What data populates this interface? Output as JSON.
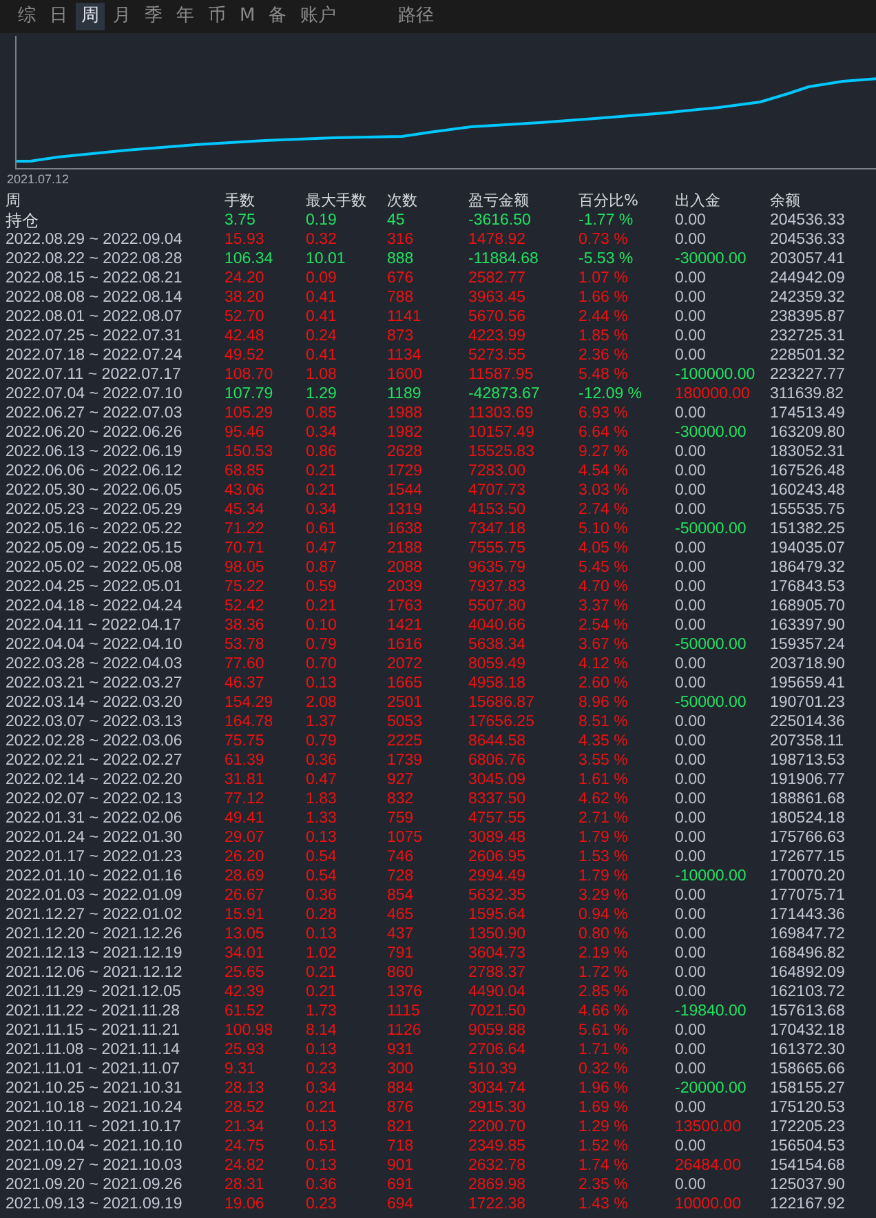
{
  "tabs": [
    {
      "label": "综",
      "selected": false
    },
    {
      "label": "日",
      "selected": false
    },
    {
      "label": "周",
      "selected": true
    },
    {
      "label": "月",
      "selected": false
    },
    {
      "label": "季",
      "selected": false
    },
    {
      "label": "年",
      "selected": false
    },
    {
      "label": "币",
      "selected": false
    },
    {
      "label": "M",
      "selected": false
    },
    {
      "label": "备",
      "selected": false
    },
    {
      "label": "账户",
      "selected": false
    },
    {
      "label": "路径",
      "selected": false
    }
  ],
  "chart": {
    "start_label": "2021.07.12"
  },
  "table": {
    "columns": [
      "周",
      "手数",
      "最大手数",
      "次数",
      "盈亏金额",
      "百分比%",
      "出入金",
      "余额"
    ],
    "rows": [
      {
        "period": "持仓",
        "lots": "3.75",
        "max_lots": "0.19",
        "count": "45",
        "pnl": "-3616.50",
        "pct": "-1.77 %",
        "flow": {
          "text": "0.00",
          "color": "#b8c0cc"
        },
        "balance": "204536.33",
        "kind": "loss"
      },
      {
        "period": "2022.08.29 ~ 2022.09.04",
        "lots": "15.93",
        "max_lots": "0.32",
        "count": "316",
        "pnl": "1478.92",
        "pct": "0.73 %",
        "flow": {
          "text": "0.00",
          "color": "#b8c0cc"
        },
        "balance": "204536.33",
        "kind": "gain"
      },
      {
        "period": "2022.08.22 ~ 2022.08.28",
        "lots": "106.34",
        "max_lots": "10.01",
        "count": "888",
        "pnl": "-11884.68",
        "pct": "-5.53 %",
        "flow": {
          "text": "-30000.00",
          "color": "#22e060"
        },
        "balance": "203057.41",
        "kind": "loss"
      },
      {
        "period": "2022.08.15 ~ 2022.08.21",
        "lots": "24.20",
        "max_lots": "0.09",
        "count": "676",
        "pnl": "2582.77",
        "pct": "1.07 %",
        "flow": {
          "text": "0.00",
          "color": "#b8c0cc"
        },
        "balance": "244942.09",
        "kind": "gain"
      },
      {
        "period": "2022.08.08 ~ 2022.08.14",
        "lots": "38.20",
        "max_lots": "0.41",
        "count": "788",
        "pnl": "3963.45",
        "pct": "1.66 %",
        "flow": {
          "text": "0.00",
          "color": "#b8c0cc"
        },
        "balance": "242359.32",
        "kind": "gain"
      },
      {
        "period": "2022.08.01 ~ 2022.08.07",
        "lots": "52.70",
        "max_lots": "0.41",
        "count": "1141",
        "pnl": "5670.56",
        "pct": "2.44 %",
        "flow": {
          "text": "0.00",
          "color": "#b8c0cc"
        },
        "balance": "238395.87",
        "kind": "gain"
      },
      {
        "period": "2022.07.25 ~ 2022.07.31",
        "lots": "42.48",
        "max_lots": "0.24",
        "count": "873",
        "pnl": "4223.99",
        "pct": "1.85 %",
        "flow": {
          "text": "0.00",
          "color": "#b8c0cc"
        },
        "balance": "232725.31",
        "kind": "gain"
      },
      {
        "period": "2022.07.18 ~ 2022.07.24",
        "lots": "49.52",
        "max_lots": "0.41",
        "count": "1134",
        "pnl": "5273.55",
        "pct": "2.36 %",
        "flow": {
          "text": "0.00",
          "color": "#b8c0cc"
        },
        "balance": "228501.32",
        "kind": "gain"
      },
      {
        "period": "2022.07.11 ~ 2022.07.17",
        "lots": "108.70",
        "max_lots": "1.08",
        "count": "1600",
        "pnl": "11587.95",
        "pct": "5.48 %",
        "flow": {
          "text": "-100000.00",
          "color": "#22e060"
        },
        "balance": "223227.77",
        "kind": "gain"
      },
      {
        "period": "2022.07.04 ~ 2022.07.10",
        "lots": "107.79",
        "max_lots": "1.29",
        "count": "1189",
        "pnl": "-42873.67",
        "pct": "-12.09 %",
        "flow": {
          "text": "180000.00",
          "color": "#ee1111"
        },
        "balance": "311639.82",
        "kind": "loss"
      },
      {
        "period": "2022.06.27 ~ 2022.07.03",
        "lots": "105.29",
        "max_lots": "0.85",
        "count": "1988",
        "pnl": "11303.69",
        "pct": "6.93 %",
        "flow": {
          "text": "0.00",
          "color": "#b8c0cc"
        },
        "balance": "174513.49",
        "kind": "gain"
      },
      {
        "period": "2022.06.20 ~ 2022.06.26",
        "lots": "95.46",
        "max_lots": "0.34",
        "count": "1982",
        "pnl": "10157.49",
        "pct": "6.64 %",
        "flow": {
          "text": "-30000.00",
          "color": "#22e060"
        },
        "balance": "163209.80",
        "kind": "gain"
      },
      {
        "period": "2022.06.13 ~ 2022.06.19",
        "lots": "150.53",
        "max_lots": "0.86",
        "count": "2628",
        "pnl": "15525.83",
        "pct": "9.27 %",
        "flow": {
          "text": "0.00",
          "color": "#b8c0cc"
        },
        "balance": "183052.31",
        "kind": "gain"
      },
      {
        "period": "2022.06.06 ~ 2022.06.12",
        "lots": "68.85",
        "max_lots": "0.21",
        "count": "1729",
        "pnl": "7283.00",
        "pct": "4.54 %",
        "flow": {
          "text": "0.00",
          "color": "#b8c0cc"
        },
        "balance": "167526.48",
        "kind": "gain"
      },
      {
        "period": "2022.05.30 ~ 2022.06.05",
        "lots": "43.06",
        "max_lots": "0.21",
        "count": "1544",
        "pnl": "4707.73",
        "pct": "3.03 %",
        "flow": {
          "text": "0.00",
          "color": "#b8c0cc"
        },
        "balance": "160243.48",
        "kind": "gain"
      },
      {
        "period": "2022.05.23 ~ 2022.05.29",
        "lots": "45.34",
        "max_lots": "0.34",
        "count": "1319",
        "pnl": "4153.50",
        "pct": "2.74 %",
        "flow": {
          "text": "0.00",
          "color": "#b8c0cc"
        },
        "balance": "155535.75",
        "kind": "gain"
      },
      {
        "period": "2022.05.16 ~ 2022.05.22",
        "lots": "71.22",
        "max_lots": "0.61",
        "count": "1638",
        "pnl": "7347.18",
        "pct": "5.10 %",
        "flow": {
          "text": "-50000.00",
          "color": "#22e060"
        },
        "balance": "151382.25",
        "kind": "gain"
      },
      {
        "period": "2022.05.09 ~ 2022.05.15",
        "lots": "70.71",
        "max_lots": "0.47",
        "count": "2188",
        "pnl": "7555.75",
        "pct": "4.05 %",
        "flow": {
          "text": "0.00",
          "color": "#b8c0cc"
        },
        "balance": "194035.07",
        "kind": "gain"
      },
      {
        "period": "2022.05.02 ~ 2022.05.08",
        "lots": "98.05",
        "max_lots": "0.87",
        "count": "2088",
        "pnl": "9635.79",
        "pct": "5.45 %",
        "flow": {
          "text": "0.00",
          "color": "#b8c0cc"
        },
        "balance": "186479.32",
        "kind": "gain"
      },
      {
        "period": "2022.04.25 ~ 2022.05.01",
        "lots": "75.22",
        "max_lots": "0.59",
        "count": "2039",
        "pnl": "7937.83",
        "pct": "4.70 %",
        "flow": {
          "text": "0.00",
          "color": "#b8c0cc"
        },
        "balance": "176843.53",
        "kind": "gain"
      },
      {
        "period": "2022.04.18 ~ 2022.04.24",
        "lots": "52.42",
        "max_lots": "0.21",
        "count": "1763",
        "pnl": "5507.80",
        "pct": "3.37 %",
        "flow": {
          "text": "0.00",
          "color": "#b8c0cc"
        },
        "balance": "168905.70",
        "kind": "gain"
      },
      {
        "period": "2022.04.11 ~ 2022.04.17",
        "lots": "38.36",
        "max_lots": "0.10",
        "count": "1421",
        "pnl": "4040.66",
        "pct": "2.54 %",
        "flow": {
          "text": "0.00",
          "color": "#b8c0cc"
        },
        "balance": "163397.90",
        "kind": "gain"
      },
      {
        "period": "2022.04.04 ~ 2022.04.10",
        "lots": "53.78",
        "max_lots": "0.79",
        "count": "1616",
        "pnl": "5638.34",
        "pct": "3.67 %",
        "flow": {
          "text": "-50000.00",
          "color": "#22e060"
        },
        "balance": "159357.24",
        "kind": "gain"
      },
      {
        "period": "2022.03.28 ~ 2022.04.03",
        "lots": "77.60",
        "max_lots": "0.70",
        "count": "2072",
        "pnl": "8059.49",
        "pct": "4.12 %",
        "flow": {
          "text": "0.00",
          "color": "#b8c0cc"
        },
        "balance": "203718.90",
        "kind": "gain"
      },
      {
        "period": "2022.03.21 ~ 2022.03.27",
        "lots": "46.37",
        "max_lots": "0.13",
        "count": "1665",
        "pnl": "4958.18",
        "pct": "2.60 %",
        "flow": {
          "text": "0.00",
          "color": "#b8c0cc"
        },
        "balance": "195659.41",
        "kind": "gain"
      },
      {
        "period": "2022.03.14 ~ 2022.03.20",
        "lots": "154.29",
        "max_lots": "2.08",
        "count": "2501",
        "pnl": "15686.87",
        "pct": "8.96 %",
        "flow": {
          "text": "-50000.00",
          "color": "#22e060"
        },
        "balance": "190701.23",
        "kind": "gain"
      },
      {
        "period": "2022.03.07 ~ 2022.03.13",
        "lots": "164.78",
        "max_lots": "1.37",
        "count": "5053",
        "pnl": "17656.25",
        "pct": "8.51 %",
        "flow": {
          "text": "0.00",
          "color": "#b8c0cc"
        },
        "balance": "225014.36",
        "kind": "gain"
      },
      {
        "period": "2022.02.28 ~ 2022.03.06",
        "lots": "75.75",
        "max_lots": "0.79",
        "count": "2225",
        "pnl": "8644.58",
        "pct": "4.35 %",
        "flow": {
          "text": "0.00",
          "color": "#b8c0cc"
        },
        "balance": "207358.11",
        "kind": "gain"
      },
      {
        "period": "2022.02.21 ~ 2022.02.27",
        "lots": "61.39",
        "max_lots": "0.36",
        "count": "1739",
        "pnl": "6806.76",
        "pct": "3.55 %",
        "flow": {
          "text": "0.00",
          "color": "#b8c0cc"
        },
        "balance": "198713.53",
        "kind": "gain"
      },
      {
        "period": "2022.02.14 ~ 2022.02.20",
        "lots": "31.81",
        "max_lots": "0.47",
        "count": "927",
        "pnl": "3045.09",
        "pct": "1.61 %",
        "flow": {
          "text": "0.00",
          "color": "#b8c0cc"
        },
        "balance": "191906.77",
        "kind": "gain"
      },
      {
        "period": "2022.02.07 ~ 2022.02.13",
        "lots": "77.12",
        "max_lots": "1.83",
        "count": "832",
        "pnl": "8337.50",
        "pct": "4.62 %",
        "flow": {
          "text": "0.00",
          "color": "#b8c0cc"
        },
        "balance": "188861.68",
        "kind": "gain"
      },
      {
        "period": "2022.01.31 ~ 2022.02.06",
        "lots": "49.41",
        "max_lots": "1.33",
        "count": "759",
        "pnl": "4757.55",
        "pct": "2.71 %",
        "flow": {
          "text": "0.00",
          "color": "#b8c0cc"
        },
        "balance": "180524.18",
        "kind": "gain"
      },
      {
        "period": "2022.01.24 ~ 2022.01.30",
        "lots": "29.07",
        "max_lots": "0.13",
        "count": "1075",
        "pnl": "3089.48",
        "pct": "1.79 %",
        "flow": {
          "text": "0.00",
          "color": "#b8c0cc"
        },
        "balance": "175766.63",
        "kind": "gain"
      },
      {
        "period": "2022.01.17 ~ 2022.01.23",
        "lots": "26.20",
        "max_lots": "0.54",
        "count": "746",
        "pnl": "2606.95",
        "pct": "1.53 %",
        "flow": {
          "text": "0.00",
          "color": "#b8c0cc"
        },
        "balance": "172677.15",
        "kind": "gain"
      },
      {
        "period": "2022.01.10 ~ 2022.01.16",
        "lots": "28.69",
        "max_lots": "0.54",
        "count": "728",
        "pnl": "2994.49",
        "pct": "1.79 %",
        "flow": {
          "text": "-10000.00",
          "color": "#22e060"
        },
        "balance": "170070.20",
        "kind": "gain"
      },
      {
        "period": "2022.01.03 ~ 2022.01.09",
        "lots": "26.67",
        "max_lots": "0.36",
        "count": "854",
        "pnl": "5632.35",
        "pct": "3.29 %",
        "flow": {
          "text": "0.00",
          "color": "#b8c0cc"
        },
        "balance": "177075.71",
        "kind": "gain"
      },
      {
        "period": "2021.12.27 ~ 2022.01.02",
        "lots": "15.91",
        "max_lots": "0.28",
        "count": "465",
        "pnl": "1595.64",
        "pct": "0.94 %",
        "flow": {
          "text": "0.00",
          "color": "#b8c0cc"
        },
        "balance": "171443.36",
        "kind": "gain"
      },
      {
        "period": "2021.12.20 ~ 2021.12.26",
        "lots": "13.05",
        "max_lots": "0.13",
        "count": "437",
        "pnl": "1350.90",
        "pct": "0.80 %",
        "flow": {
          "text": "0.00",
          "color": "#b8c0cc"
        },
        "balance": "169847.72",
        "kind": "gain"
      },
      {
        "period": "2021.12.13 ~ 2021.12.19",
        "lots": "34.01",
        "max_lots": "1.02",
        "count": "791",
        "pnl": "3604.73",
        "pct": "2.19 %",
        "flow": {
          "text": "0.00",
          "color": "#b8c0cc"
        },
        "balance": "168496.82",
        "kind": "gain"
      },
      {
        "period": "2021.12.06 ~ 2021.12.12",
        "lots": "25.65",
        "max_lots": "0.21",
        "count": "860",
        "pnl": "2788.37",
        "pct": "1.72 %",
        "flow": {
          "text": "0.00",
          "color": "#b8c0cc"
        },
        "balance": "164892.09",
        "kind": "gain"
      },
      {
        "period": "2021.11.29 ~ 2021.12.05",
        "lots": "42.39",
        "max_lots": "0.21",
        "count": "1376",
        "pnl": "4490.04",
        "pct": "2.85 %",
        "flow": {
          "text": "0.00",
          "color": "#b8c0cc"
        },
        "balance": "162103.72",
        "kind": "gain"
      },
      {
        "period": "2021.11.22 ~ 2021.11.28",
        "lots": "61.52",
        "max_lots": "1.73",
        "count": "1115",
        "pnl": "7021.50",
        "pct": "4.66 %",
        "flow": {
          "text": "-19840.00",
          "color": "#22e060"
        },
        "balance": "157613.68",
        "kind": "gain"
      },
      {
        "period": "2021.11.15 ~ 2021.11.21",
        "lots": "100.98",
        "max_lots": "8.14",
        "count": "1126",
        "pnl": "9059.88",
        "pct": "5.61 %",
        "flow": {
          "text": "0.00",
          "color": "#b8c0cc"
        },
        "balance": "170432.18",
        "kind": "gain"
      },
      {
        "period": "2021.11.08 ~ 2021.11.14",
        "lots": "25.93",
        "max_lots": "0.13",
        "count": "931",
        "pnl": "2706.64",
        "pct": "1.71 %",
        "flow": {
          "text": "0.00",
          "color": "#b8c0cc"
        },
        "balance": "161372.30",
        "kind": "gain"
      },
      {
        "period": "2021.11.01 ~ 2021.11.07",
        "lots": "9.31",
        "max_lots": "0.23",
        "count": "300",
        "pnl": "510.39",
        "pct": "0.32 %",
        "flow": {
          "text": "0.00",
          "color": "#b8c0cc"
        },
        "balance": "158665.66",
        "kind": "gain"
      },
      {
        "period": "2021.10.25 ~ 2021.10.31",
        "lots": "28.13",
        "max_lots": "0.34",
        "count": "884",
        "pnl": "3034.74",
        "pct": "1.96 %",
        "flow": {
          "text": "-20000.00",
          "color": "#22e060"
        },
        "balance": "158155.27",
        "kind": "gain"
      },
      {
        "period": "2021.10.18 ~ 2021.10.24",
        "lots": "28.52",
        "max_lots": "0.21",
        "count": "876",
        "pnl": "2915.30",
        "pct": "1.69 %",
        "flow": {
          "text": "0.00",
          "color": "#b8c0cc"
        },
        "balance": "175120.53",
        "kind": "gain"
      },
      {
        "period": "2021.10.11 ~ 2021.10.17",
        "lots": "21.34",
        "max_lots": "0.13",
        "count": "821",
        "pnl": "2200.70",
        "pct": "1.29 %",
        "flow": {
          "text": "13500.00",
          "color": "#ee1111"
        },
        "balance": "172205.23",
        "kind": "gain"
      },
      {
        "period": "2021.10.04 ~ 2021.10.10",
        "lots": "24.75",
        "max_lots": "0.51",
        "count": "718",
        "pnl": "2349.85",
        "pct": "1.52 %",
        "flow": {
          "text": "0.00",
          "color": "#b8c0cc"
        },
        "balance": "156504.53",
        "kind": "gain"
      },
      {
        "period": "2021.09.27 ~ 2021.10.03",
        "lots": "24.82",
        "max_lots": "0.13",
        "count": "901",
        "pnl": "2632.78",
        "pct": "1.74 %",
        "flow": {
          "text": "26484.00",
          "color": "#ee1111"
        },
        "balance": "154154.68",
        "kind": "gain"
      },
      {
        "period": "2021.09.20 ~ 2021.09.26",
        "lots": "28.31",
        "max_lots": "0.36",
        "count": "691",
        "pnl": "2869.98",
        "pct": "2.35 %",
        "flow": {
          "text": "0.00",
          "color": "#b8c0cc"
        },
        "balance": "125037.90",
        "kind": "gain"
      },
      {
        "period": "2021.09.13 ~ 2021.09.19",
        "lots": "19.06",
        "max_lots": "0.23",
        "count": "694",
        "pnl": "1722.38",
        "pct": "1.43 %",
        "flow": {
          "text": "10000.00",
          "color": "#ee1111"
        },
        "balance": "122167.92",
        "kind": "gain"
      }
    ]
  }
}
